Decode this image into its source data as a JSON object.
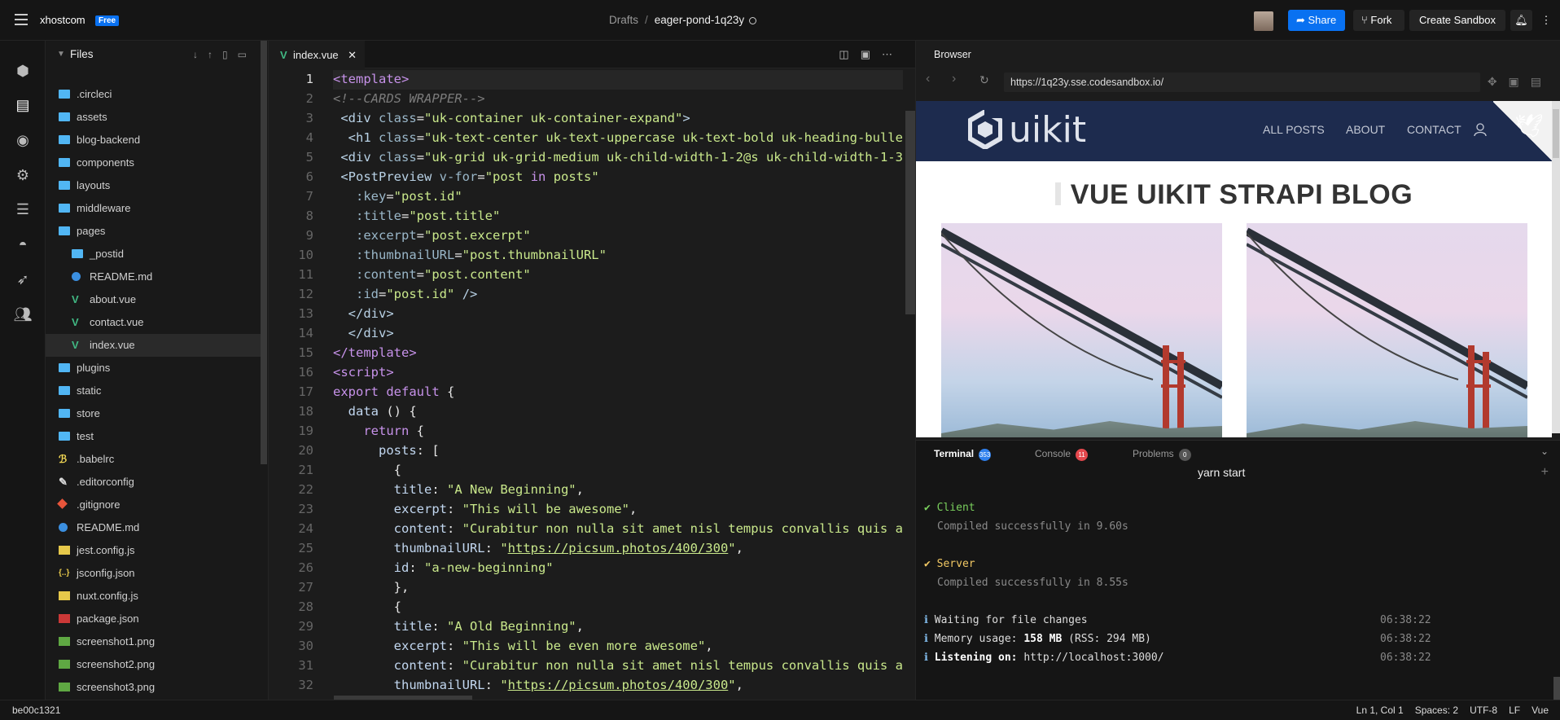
{
  "topbar": {
    "brand": "xhostcom",
    "plan": "Free",
    "crumb_parent": "Drafts",
    "crumb_sep": "/",
    "sandbox_name": "eager-pond-1q23y",
    "share": "Share",
    "fork": "Fork",
    "create": "Create Sandbox"
  },
  "files": {
    "title": "Files",
    "items": [
      {
        "name": ".circleci",
        "type": "folder",
        "depth": 0
      },
      {
        "name": "assets",
        "type": "folder",
        "depth": 0
      },
      {
        "name": "blog-backend",
        "type": "folder",
        "depth": 0
      },
      {
        "name": "components",
        "type": "folder",
        "depth": 0
      },
      {
        "name": "layouts",
        "type": "folder",
        "depth": 0
      },
      {
        "name": "middleware",
        "type": "folder",
        "depth": 0
      },
      {
        "name": "pages",
        "type": "folder-open",
        "depth": 0
      },
      {
        "name": "_postid",
        "type": "folder",
        "depth": 1
      },
      {
        "name": "README.md",
        "type": "info",
        "depth": 1
      },
      {
        "name": "about.vue",
        "type": "vue",
        "depth": 1
      },
      {
        "name": "contact.vue",
        "type": "vue",
        "depth": 1
      },
      {
        "name": "index.vue",
        "type": "vue",
        "depth": 1,
        "selected": true
      },
      {
        "name": "plugins",
        "type": "folder",
        "depth": 0
      },
      {
        "name": "static",
        "type": "folder",
        "depth": 0
      },
      {
        "name": "store",
        "type": "folder",
        "depth": 0
      },
      {
        "name": "test",
        "type": "folder",
        "depth": 0
      },
      {
        "name": ".babelrc",
        "type": "babel",
        "depth": 0
      },
      {
        "name": ".editorconfig",
        "type": "config",
        "depth": 0
      },
      {
        "name": ".gitignore",
        "type": "git",
        "depth": 0
      },
      {
        "name": "README.md",
        "type": "info",
        "depth": 0
      },
      {
        "name": "jest.config.js",
        "type": "js",
        "depth": 0
      },
      {
        "name": "jsconfig.json",
        "type": "json",
        "depth": 0
      },
      {
        "name": "nuxt.config.js",
        "type": "js",
        "depth": 0
      },
      {
        "name": "package.json",
        "type": "npm",
        "depth": 0
      },
      {
        "name": "screenshot1.png",
        "type": "img",
        "depth": 0
      },
      {
        "name": "screenshot2.png",
        "type": "img",
        "depth": 0
      },
      {
        "name": "screenshot3.png",
        "type": "img",
        "depth": 0
      }
    ]
  },
  "editor": {
    "tab": "index.vue",
    "current_line": 1
  },
  "browser": {
    "title": "Browser",
    "url": "https://1q23y.sse.codesandbox.io/",
    "logo": "uikit",
    "nav": [
      "ALL POSTS",
      "ABOUT",
      "CONTACT"
    ],
    "heading": "VUE UIKIT STRAPI BLOG"
  },
  "terminal": {
    "tabs": [
      {
        "label": "Terminal",
        "count": "353",
        "color": "#2f80ed"
      },
      {
        "label": "Console",
        "count": "11",
        "color": "#e5484d"
      },
      {
        "label": "Problems",
        "count": "0",
        "color": "#555"
      }
    ],
    "command": "yarn start",
    "client_label": "Client",
    "client_msg": "Compiled successfully in 9.60s",
    "server_label": "Server",
    "server_msg": "Compiled successfully in 8.55s",
    "waiting": "Waiting for file changes",
    "mem_label": "Memory usage:",
    "mem_value": "158 MB",
    "mem_rss": "(RSS: 294 MB)",
    "listen_label": "Listening on:",
    "listen_value": "http://localhost:3000/",
    "time": "06:38:22"
  },
  "status": {
    "commit": "be00c1321",
    "position": "Ln 1, Col 1",
    "spaces": "Spaces: 2",
    "encoding": "UTF-8",
    "eol": "LF",
    "lang": "Vue"
  }
}
